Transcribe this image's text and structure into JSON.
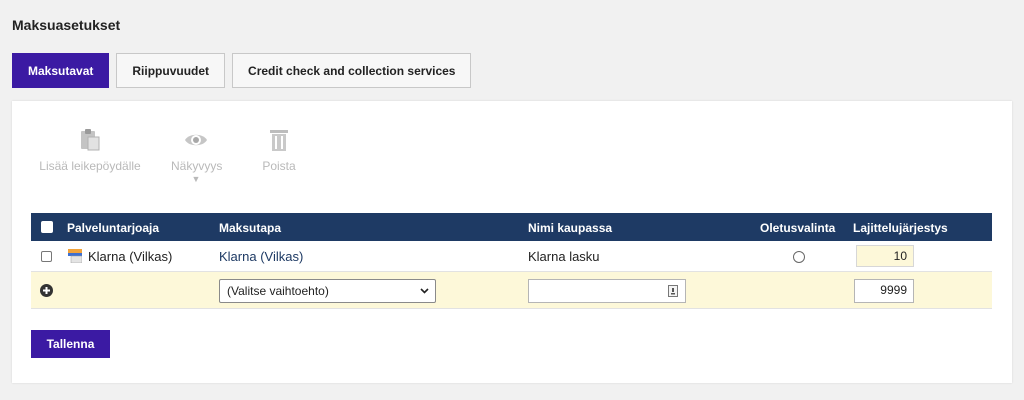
{
  "page": {
    "title": "Maksuasetukset"
  },
  "tabs": [
    {
      "label": "Maksutavat",
      "active": true
    },
    {
      "label": "Riippuvuudet",
      "active": false
    },
    {
      "label": "Credit check and collection services",
      "active": false
    }
  ],
  "toolbar": {
    "copy_label": "Lisää leikepöydälle",
    "visibility_label": "Näkyvyys",
    "delete_label": "Poista",
    "visibility_caret": "▼"
  },
  "grid": {
    "columns": [
      "Palveluntarjoaja",
      "Maksutapa",
      "Nimi kaupassa",
      "Oletusvalinta",
      "Lajittelujärjestys"
    ],
    "rows": [
      {
        "provider": "Klarna (Vilkas)",
        "method": "Klarna (Vilkas)",
        "store_name": "Klarna lasku",
        "default": false,
        "sort_order": "10"
      }
    ],
    "new_row": {
      "select_value": "(Valitse vaihtoehto)",
      "store_name": "",
      "sort_order": "9999"
    }
  },
  "actions": {
    "save_label": "Tallenna"
  },
  "colors": {
    "accent": "#3b1aa3",
    "header": "#1e3a64",
    "highlight": "#fdf8d9",
    "link": "#1e3a64"
  }
}
